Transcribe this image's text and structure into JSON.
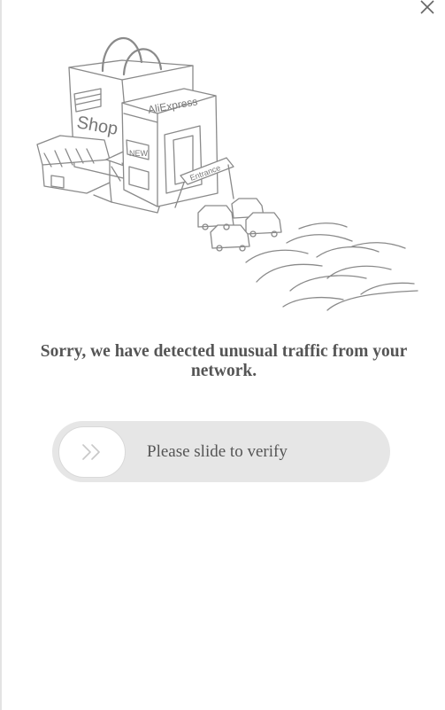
{
  "dialog": {
    "close_icon": "close-icon"
  },
  "illustration": {
    "shop_sign": "Shop",
    "store_sign": "AliExpress",
    "new_sign": "NEW",
    "entrance_sign": "Entrance"
  },
  "message": {
    "headline": "Sorry, we have detected unusual traffic from your network."
  },
  "slider": {
    "label": "Please slide to verify",
    "handle_icon": "double-chevron-right-icon",
    "progress": 0
  },
  "colors": {
    "text": "#555555",
    "track": "#e6e6e6",
    "handle": "#ffffff",
    "line_art": "#888888"
  }
}
